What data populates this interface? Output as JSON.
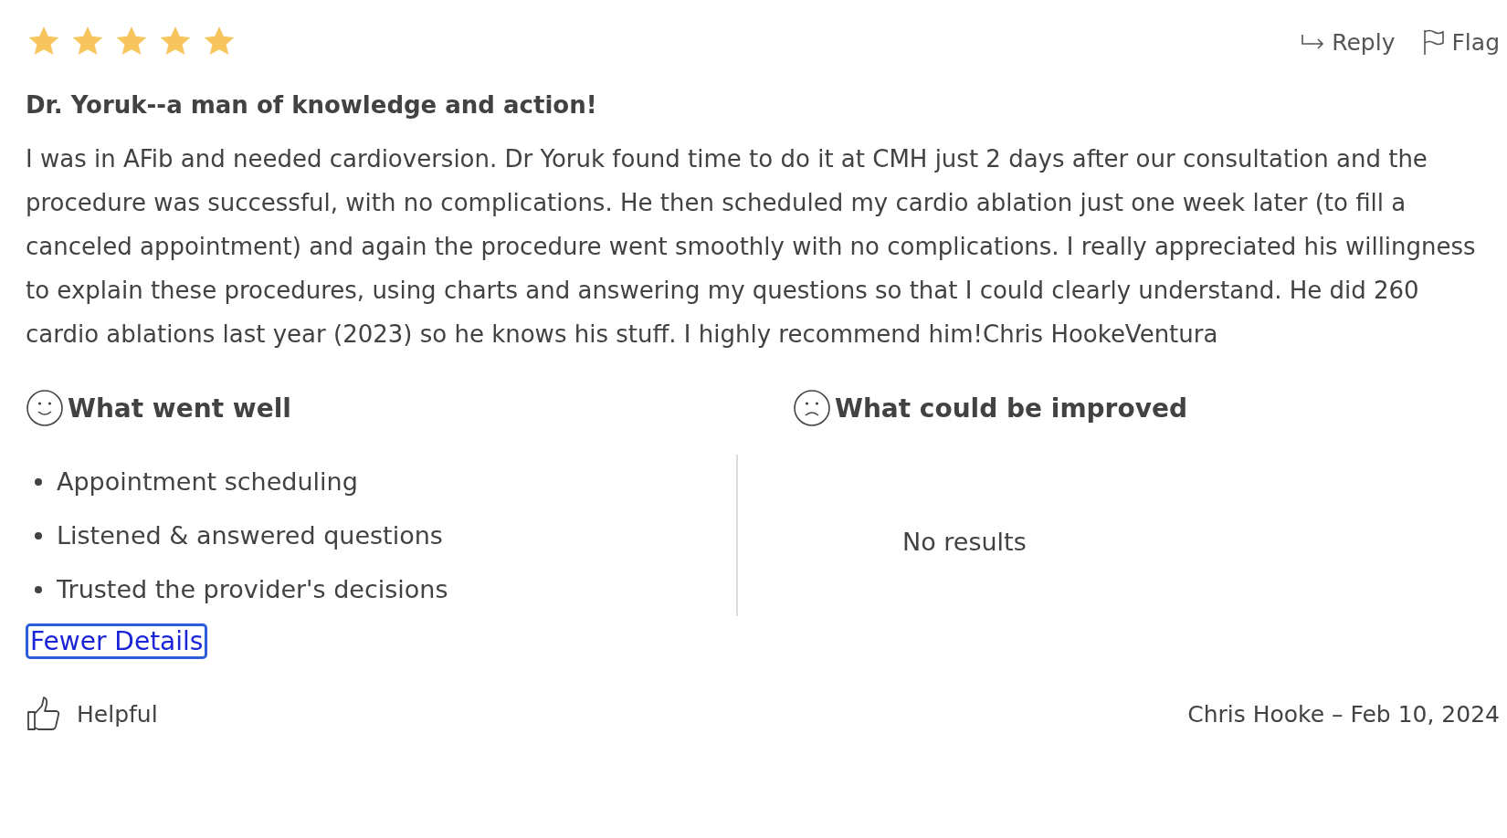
{
  "review": {
    "stars": 5,
    "actions": [
      "Reply",
      "Flag"
    ],
    "title": "Dr. Yoruk--a man of knowledge and action!",
    "body": "I was in AFib and needed cardioversion. Dr Yoruk found time to do it at CMH just 2 days after our consultation and the procedure was successful, with no complications. He then scheduled my cardio ablation just one week later (to fill a canceled appointment) and again the procedure went smoothly with no complications. I really appreciated his willingness to explain these procedures, using charts and answering my questions so that I could clearly understand. He did 260 cardio ablations last year (2023) so he knows his stuff. I highly recommend him!Chris HookeVentura"
  },
  "went_well": {
    "heading": "What went well",
    "items": [
      "Appointment scheduling",
      "Listened & answered questions",
      "Trusted the provider's decisions"
    ]
  },
  "could_improve": {
    "heading": "What could be improved",
    "empty_text": "No results"
  },
  "details_toggle": {
    "label": "Fewer Details",
    "focused": true
  },
  "footer": {
    "helpful": "Helpful",
    "author_date": "Chris Hooke – Feb 10, 2024"
  }
}
